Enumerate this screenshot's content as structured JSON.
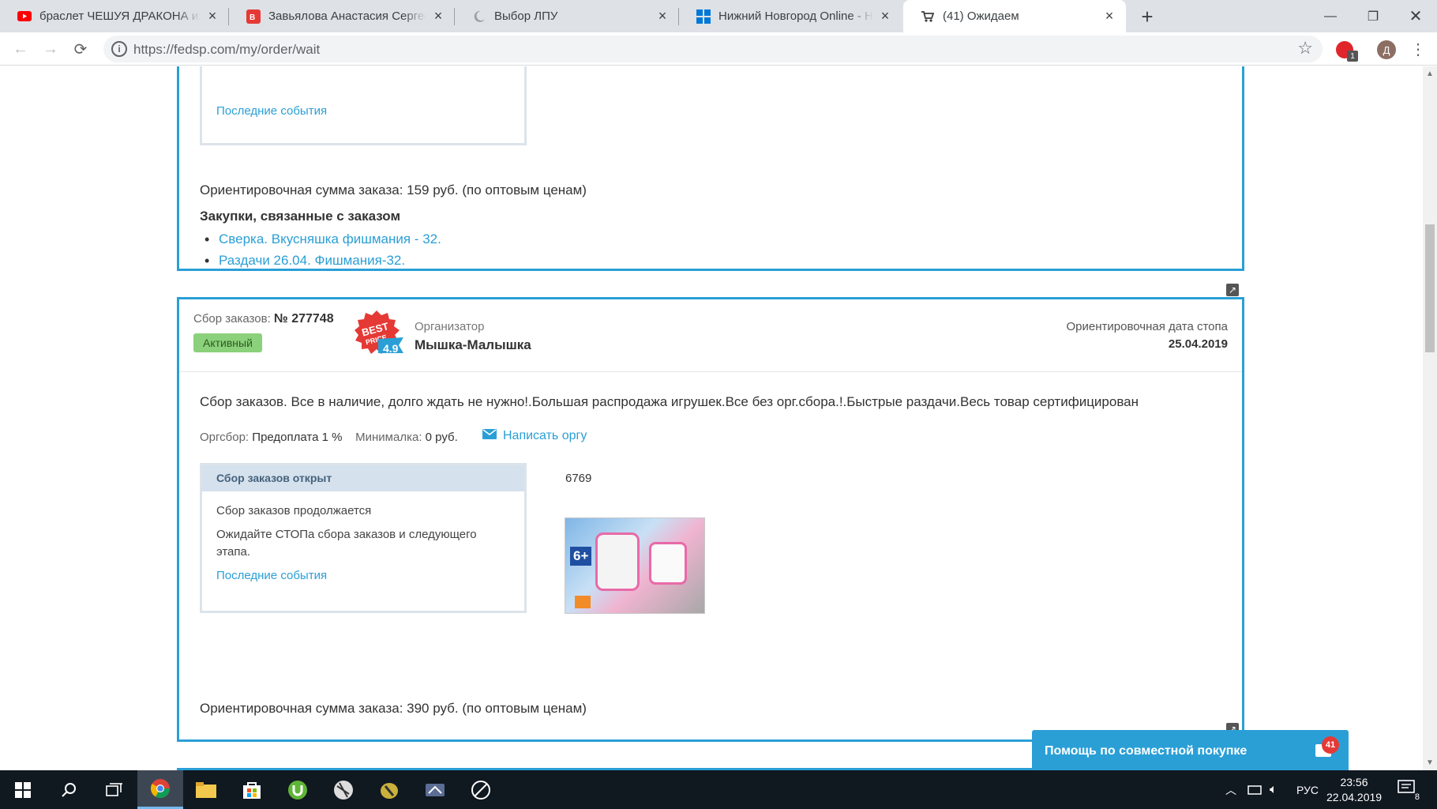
{
  "browser": {
    "tabs": [
      {
        "title": "браслет ЧЕШУЯ ДРАКОНА из ре",
        "icon": "youtube-icon",
        "color": "#ff0000"
      },
      {
        "title": "Завьялова Анастасия Сергеевна",
        "icon": "vk-icon",
        "color": "#e53935"
      },
      {
        "title": "Выбор ЛПУ",
        "icon": "moon-icon",
        "color": "#9aa0a6"
      },
      {
        "title": "Нижний Новгород Online - Ниж",
        "icon": "windows-tiles-icon",
        "color": "#0078d7"
      },
      {
        "title": "(41) Ожидаем",
        "icon": "cart-icon",
        "color": "#3c4043"
      }
    ],
    "url": "https://fedsp.com/my/order/wait",
    "profile_letter": "Д",
    "extension_badge": "1"
  },
  "card1": {
    "last_events": "Последние события",
    "order_sum": "Ориентировочная сумма заказа: 159 руб. (по оптовым ценам)",
    "related_title": "Закупки, связанные с заказом",
    "related_links": [
      "Сверка. Вкусняшка фишмания - 32.",
      "Раздачи 26.04. Фишмания-32."
    ]
  },
  "card2": {
    "collection_label": "Сбор заказов:",
    "collection_number": "№ 277748",
    "status": "Активный",
    "rating": "4.9",
    "organizer_label": "Организатор",
    "organizer_name": "Мышка-Малышка",
    "stop_date_label": "Ориентировочная дата стопа",
    "stop_date": "25.04.2019",
    "title_link": "Сбор заказов. Все в наличие, долго ждать не нужно!.Большая распродажа игрушек.Все без орг.сбора.!.Быстрые раздачи.Весь товар сертифицирован",
    "org_fee_label": "Оргсбор:",
    "org_fee_value": "Предоплата 1 %",
    "min_label": "Минималка:",
    "min_value": "0 руб.",
    "write_org": "Написать оргу",
    "panel_title": "Сбор заказов открыт",
    "panel_line1": "Сбор заказов продолжается",
    "panel_line2": "Ожидайте СТОПа сбора заказов и следующего этапа.",
    "last_events": "Последние события",
    "product_link": "6769",
    "product_badge": "6+",
    "order_sum": "Ориентировочная сумма заказа: 390 руб. (по оптовым ценам)"
  },
  "help_widget": {
    "label": "Помощь по совместной покупке",
    "count": "41"
  },
  "taskbar": {
    "language": "РУС",
    "time": "23:56",
    "date": "22.04.2019",
    "notifications": "8"
  }
}
